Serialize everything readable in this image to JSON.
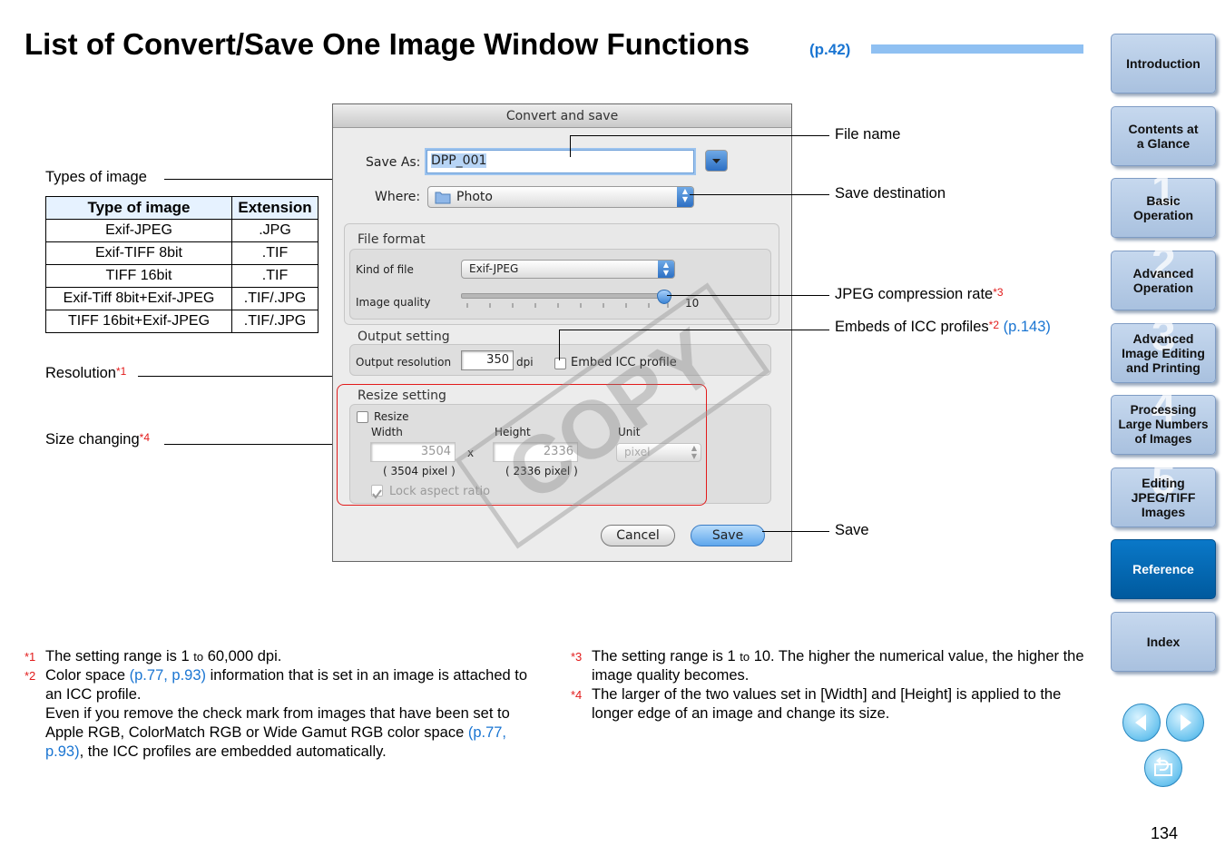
{
  "page": {
    "title": "List of Convert/Save One Image Window Functions",
    "title_ref": "(p.42)",
    "page_number": "134"
  },
  "nav": {
    "items": [
      {
        "label": "Introduction",
        "num": ""
      },
      {
        "label": "Contents at\na Glance",
        "num": ""
      },
      {
        "label": "Basic\nOperation",
        "num": "1"
      },
      {
        "label": "Advanced\nOperation",
        "num": "2"
      },
      {
        "label": "Advanced\nImage Editing\nand Printing",
        "num": "3"
      },
      {
        "label": "Processing\nLarge Numbers\nof Images",
        "num": "4"
      },
      {
        "label": "Editing\nJPEG/TIFF\nImages",
        "num": "5"
      },
      {
        "label": "Reference",
        "num": ""
      },
      {
        "label": "Index",
        "num": ""
      }
    ]
  },
  "table": {
    "headers": [
      "Type of image",
      "Extension"
    ],
    "rows": [
      [
        "Exif-JPEG",
        ".JPG"
      ],
      [
        "Exif-TIFF 8bit",
        ".TIF"
      ],
      [
        "TIFF 16bit",
        ".TIF"
      ],
      [
        "Exif-Tiff 8bit+Exif-JPEG",
        ".TIF/.JPG"
      ],
      [
        "TIFF 16bit+Exif-JPEG",
        ".TIF/.JPG"
      ]
    ]
  },
  "labels": {
    "types_of_image": "Types of image",
    "resolution": "Resolution",
    "resolution_mark": "*1",
    "size_changing": "Size changing",
    "size_changing_mark": "*4",
    "file_name": "File name",
    "save_destination": "Save destination",
    "jpeg_rate": "JPEG compression rate",
    "jpeg_rate_mark": "*3",
    "icc": "Embeds of ICC profiles",
    "icc_mark": "*2",
    "icc_ref": "(p.143)",
    "save": "Save"
  },
  "dialog": {
    "title": "Convert and save",
    "save_as_label": "Save As:",
    "save_as_value": "DPP_001",
    "where_label": "Where:",
    "where_value": "Photo",
    "file_format_title": "File format",
    "kind_label": "Kind of file",
    "kind_value": "Exif-JPEG",
    "quality_label": "Image quality",
    "quality_value": "10",
    "quality_level": 1.0,
    "output_title": "Output setting",
    "output_label": "Output resolution",
    "output_value": "350",
    "output_unit": "dpi",
    "embed_label": "Embed ICC profile",
    "resize_title": "Resize setting",
    "resize_label": "Resize",
    "width_label": "Width",
    "height_label": "Height",
    "unit_label": "Unit",
    "width_value": "3504",
    "height_value": "2336",
    "times": "x",
    "unit_value": "pixel",
    "width_pixel": "( 3504 pixel )",
    "height_pixel": "( 2336 pixel )",
    "lock_label": "Lock aspect ratio",
    "cancel": "Cancel",
    "save": "Save",
    "stamp": "COPY"
  },
  "footnotes": {
    "n1_mark": "*1",
    "n1_a": "The setting range is 1 ",
    "n1_to": "to",
    "n1_b": " 60,000 dpi.",
    "n2_mark": "*2",
    "n2_a": "Color space ",
    "n2_ref1": "(p.77, p.93)",
    "n2_b": " information that is set in an image is attached to an ICC profile.",
    "n2_c": "Even if you remove the check mark from images that have been set to Apple RGB, ColorMatch RGB or Wide Gamut RGB color space ",
    "n2_ref2": "(p.77, p.93)",
    "n2_d": ", the ICC profiles are embedded automatically.",
    "n3_mark": "*3",
    "n3_a": "The setting range is 1 ",
    "n3_to": "to",
    "n3_b": " 10. The higher the numerical value, the higher the image quality becomes.",
    "n4_mark": "*4",
    "n4": "The larger of the two values set in [Width] and [Height] is applied to the longer edge of an image and change its size."
  },
  "colors": {
    "accent": "#1a75d2",
    "mark_red": "#e21b1b",
    "nav_active": "#0a78c8",
    "title_bar": "#8fc0f2"
  }
}
